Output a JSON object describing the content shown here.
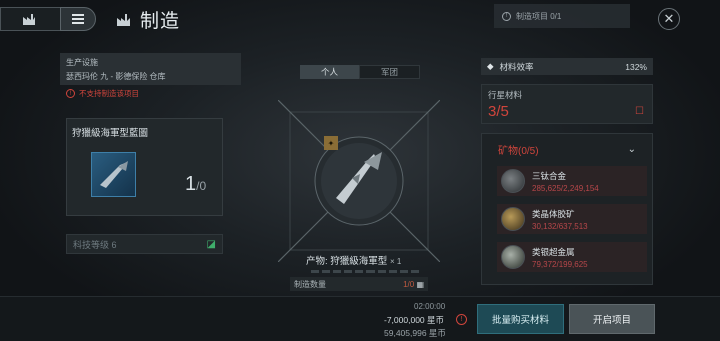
{
  "header": {
    "title": "制造",
    "project_count": "制造项目 0/1"
  },
  "facility": {
    "type_label": "生产设施",
    "location": "瑟西玛伦 九 - 影德保险 仓库",
    "warning": "不支持制造该项目"
  },
  "blueprint": {
    "name": "狩獵級海軍型藍圖",
    "count": "1",
    "total": "/0"
  },
  "tech": {
    "label": "科技等级 6"
  },
  "tabs": [
    {
      "label": "个人"
    },
    {
      "label": "军团"
    }
  ],
  "product": {
    "label": "产物:",
    "name": "狩獵級海軍型",
    "quantity": "× 1"
  },
  "manufacture": {
    "qty_label": "制造数量",
    "qty_value": "1/0"
  },
  "right": {
    "efficiency_label": "材料效率",
    "efficiency_value": "132%",
    "planet_label": "行星材料",
    "planet_value": "3/5",
    "minerals_label": "矿物(0/5)",
    "minerals": [
      {
        "name": "三钛合金",
        "amount": "285,625/2,249,154"
      },
      {
        "name": "类晶体胶矿",
        "amount": "30,132/637,513"
      },
      {
        "name": "类银超金属",
        "amount": "79,372/199,625"
      }
    ]
  },
  "footer": {
    "time": "02:00:00",
    "cost": "-7,000,000 星币",
    "balance": "59,405,996 星币",
    "buy_button": "批量购买材料",
    "start_button": "开启项目"
  },
  "colors": {
    "warning_red": "#d0453c",
    "buy_teal": "#1e4a55",
    "mineral_amount": "#b7474a"
  },
  "icons": {
    "factory": "factory-icon",
    "menu": "menu-icon",
    "close": "close-icon",
    "warning": "warning-icon",
    "diamond": "diamond-icon",
    "chevron": "chevron-down-icon"
  }
}
